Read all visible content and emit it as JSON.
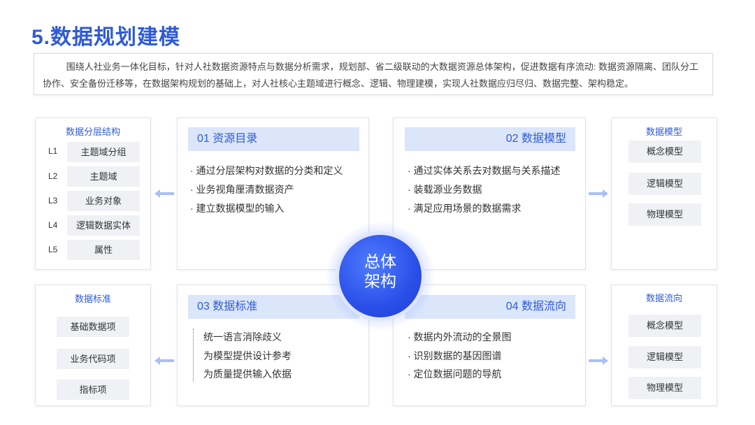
{
  "title": "5.数据规划建模",
  "intro": "围绕人社业务一体化目标，针对人社数据资源特点与数据分析需求，规划部、省二级联动的大数据资源总体架构，促进数据有序流动: 数据资源隔离、团队分工协作、安全备份迁移等，在数据架构规划的基础上，对人社核心主题域进行概念、逻辑、物理建模，实现人社数据应归尽归、数据完整、架构稳定。",
  "center": {
    "line1": "总体",
    "line2": "架构"
  },
  "left_top": {
    "title": "数据分层结构",
    "levels": [
      {
        "code": "L1",
        "label": "主题域分组"
      },
      {
        "code": "L2",
        "label": "主题域"
      },
      {
        "code": "L3",
        "label": "业务对象"
      },
      {
        "code": "L4",
        "label": "逻辑数据实体"
      },
      {
        "code": "L5",
        "label": "属性"
      }
    ]
  },
  "left_bottom": {
    "title": "数据标准",
    "items": [
      "基础数据项",
      "业务代码项",
      "指标项"
    ]
  },
  "right_top": {
    "title": "数据模型",
    "items": [
      "概念模型",
      "逻辑模型",
      "物理模型"
    ]
  },
  "right_bottom": {
    "title": "数据流向",
    "items": [
      "概念模型",
      "逻辑模型",
      "物理模型"
    ]
  },
  "panels": {
    "p1": {
      "heading": "01  资源目录",
      "bullets": [
        "· 通过分层架构对数据的分类和定义",
        "· 业务视角厘清数据资产",
        "· 建立数据模型的输入"
      ]
    },
    "p2": {
      "heading": "02  数据模型",
      "bullets": [
        "· 通过实体关系去对数据与关系描述",
        "· 装载源业务数据",
        "· 满足应用场景的数据需求"
      ]
    },
    "p3": {
      "heading": "03  数据标准",
      "bullets": [
        "统一语言消除歧义",
        "为模型提供设计参考",
        "为质量提供输入依据"
      ]
    },
    "p4": {
      "heading": "04  数据流向",
      "bullets": [
        "· 数据内外流动的全景图",
        "· 识别数据的基因图谱",
        "· 定位数据问题的导航"
      ]
    }
  },
  "colors": {
    "accent": "#2f5bd8",
    "heading_bg": "#dbe6fb",
    "chip_bg": "#eff1f4",
    "arrow": "#9db4f0"
  }
}
